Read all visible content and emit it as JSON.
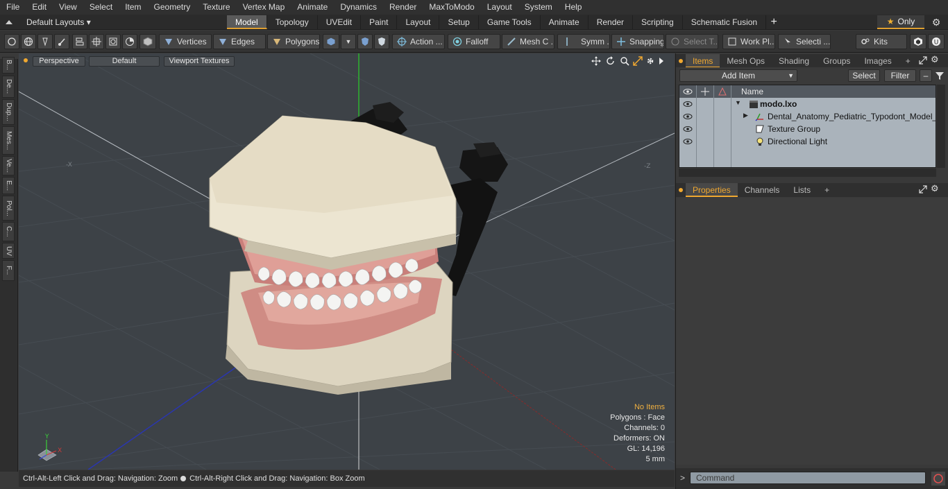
{
  "menubar": [
    "File",
    "Edit",
    "View",
    "Select",
    "Item",
    "Geometry",
    "Texture",
    "Vertex Map",
    "Animate",
    "Dynamics",
    "Render",
    "MaxToModo",
    "Layout",
    "System",
    "Help"
  ],
  "layouts": {
    "label": "Default Layouts ▾"
  },
  "tabs": [
    "Model",
    "Topology",
    "UVEdit",
    "Paint",
    "Layout",
    "Setup",
    "Game Tools",
    "Animate",
    "Render",
    "Scripting",
    "Schematic Fusion"
  ],
  "tabs_plus": "+",
  "only_label": "Only",
  "toolbar": {
    "vertices": "Vertices",
    "edges": "Edges",
    "polygons": "Polygons",
    "action": "Action ...",
    "falloff": "Falloff",
    "mesh": "Mesh C ...",
    "symm": "Symm ...",
    "snapping": "Snapping",
    "select_t": "Select T...",
    "work_pl": "Work Pl...",
    "selecti": "Selecti ...",
    "kits": "Kits"
  },
  "leftstrip": [
    "B...",
    "De...",
    "Dup...",
    "Mes...",
    "Ve...",
    "E...",
    "Pol...",
    "C...",
    "UV",
    "F..."
  ],
  "viewport": {
    "perspective": "Perspective",
    "default": "Default",
    "textures": "Viewport Textures",
    "axis_x_label": "-X",
    "axis_z_label": "-Z",
    "hud": {
      "no_items": "No Items",
      "polygons": "Polygons : Face",
      "channels": "Channels: 0",
      "deformers": "Deformers: ON",
      "gl": "GL: 14,196",
      "scale": "5 mm"
    },
    "gizmo": {
      "y": "Y",
      "x": "X"
    }
  },
  "statusbar": {
    "left": "Ctrl-Alt-Left Click and Drag: Navigation: Zoom",
    "right": "Ctrl-Alt-Right Click and Drag: Navigation: Box Zoom"
  },
  "items_panel": {
    "tabs": [
      "Items",
      "Mesh Ops",
      "Shading",
      "Groups",
      "Images"
    ],
    "plus": "+",
    "add_item": "Add Item",
    "select": "Select",
    "filter": "Filter",
    "col_name": "Name",
    "rows": [
      {
        "label": "modo.lxo",
        "bold": true
      },
      {
        "label": "Dental_Anatomy_Pediatric_Typodont_Model_wi..."
      },
      {
        "label": "Texture Group"
      },
      {
        "label": "Directional Light"
      }
    ]
  },
  "props_panel": {
    "tabs": [
      "Properties",
      "Channels",
      "Lists"
    ],
    "plus": "+"
  },
  "command": {
    "placeholder": "Command",
    "prompt": ">"
  },
  "colors": {
    "accent": "#f0a830",
    "viewport_bg": "#3d4247"
  }
}
